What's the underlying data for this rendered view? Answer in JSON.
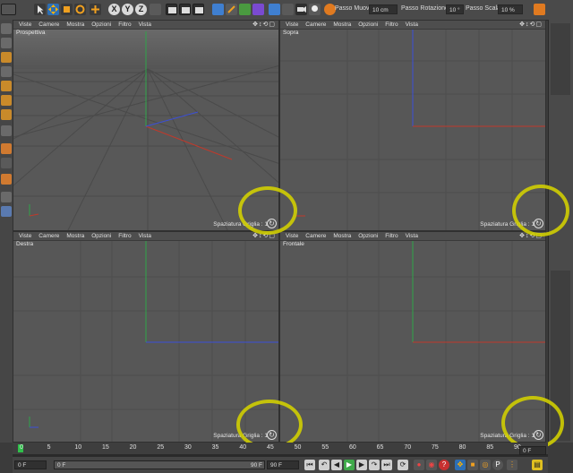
{
  "toolbar": {
    "axis_x": "X",
    "axis_y": "Y",
    "axis_z": "Z",
    "move_step_label": "Passo Muovi",
    "move_step_value": "10 cm",
    "rotate_step_label": "Passo Rotazione",
    "rotate_step_value": "10 °",
    "scale_step_label": "Passo Scala",
    "scale_step_value": "10 %"
  },
  "viewport_menu": [
    "Viste",
    "Camere",
    "Mostra",
    "Opzioni",
    "Filtro",
    "Vista"
  ],
  "viewports": [
    {
      "name": "Prospettiva",
      "grid": "Spaziatura Griglia : 1"
    },
    {
      "name": "Sopra",
      "grid": "Spaziatura Griglia : 1"
    },
    {
      "name": "Destra",
      "grid": "Spaziatura Griglia : 1"
    },
    {
      "name": "Frontale",
      "grid": "Spaziatura Griglia : 1"
    }
  ],
  "timeline": {
    "ticks": [
      "0",
      "5",
      "10",
      "15",
      "20",
      "25",
      "30",
      "35",
      "40",
      "45",
      "50",
      "55",
      "60",
      "65",
      "70",
      "75",
      "80",
      "85",
      "90"
    ],
    "end_frame": "0 F",
    "start_field": "0 F",
    "range_start": "0 F",
    "range_end": "90 F",
    "max_field": "90 F"
  },
  "colors": {
    "annotation": "#d4d200",
    "axis_x": "#c0392b",
    "axis_y": "#2fa44a",
    "axis_z": "#3b4fd8"
  }
}
